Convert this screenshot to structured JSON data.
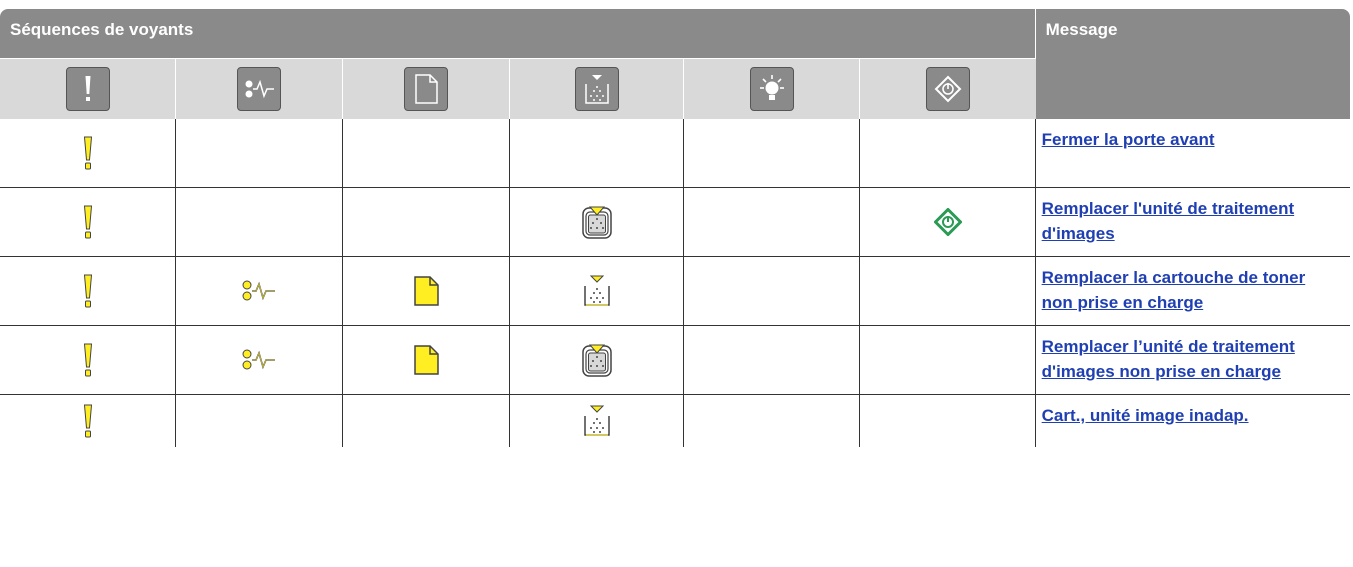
{
  "header": {
    "sequences_label": "Séquences de voyants",
    "message_label": "Message"
  },
  "icon_columns": [
    {
      "name": "error-icon"
    },
    {
      "name": "paper-jam-icon"
    },
    {
      "name": "load-paper-icon"
    },
    {
      "name": "toner-icon"
    },
    {
      "name": "ready-light-icon"
    },
    {
      "name": "start-button-icon"
    }
  ],
  "rows": [
    {
      "message": "Fermer la porte avant",
      "lights": [
        "error-icon",
        "",
        "",
        "",
        "",
        ""
      ]
    },
    {
      "message": "Remplacer l'unité de traitement d'images",
      "lights": [
        "error-icon",
        "",
        "",
        "imaging-unit-icon",
        "",
        "start-button-icon"
      ]
    },
    {
      "message": "Remplacer la cartouche de toner non prise en charge",
      "lights": [
        "error-icon",
        "paper-jam-icon",
        "load-paper-icon",
        "toner-icon",
        "",
        ""
      ]
    },
    {
      "message": "Remplacer l’unité de traitement d'images non prise en charge",
      "lights": [
        "error-icon",
        "paper-jam-icon",
        "load-paper-icon",
        "imaging-unit-icon",
        "",
        ""
      ]
    },
    {
      "message": "Cart., unité image inadap.",
      "lights": [
        "error-icon",
        "",
        "",
        "toner-icon",
        "",
        ""
      ]
    }
  ],
  "colors": {
    "header_bg": "#8a8a8a",
    "icon_row_bg": "#d9d9d9",
    "led_yellow": "#ffee22",
    "start_green": "#2a9a55",
    "link": "#1f3fb2"
  }
}
